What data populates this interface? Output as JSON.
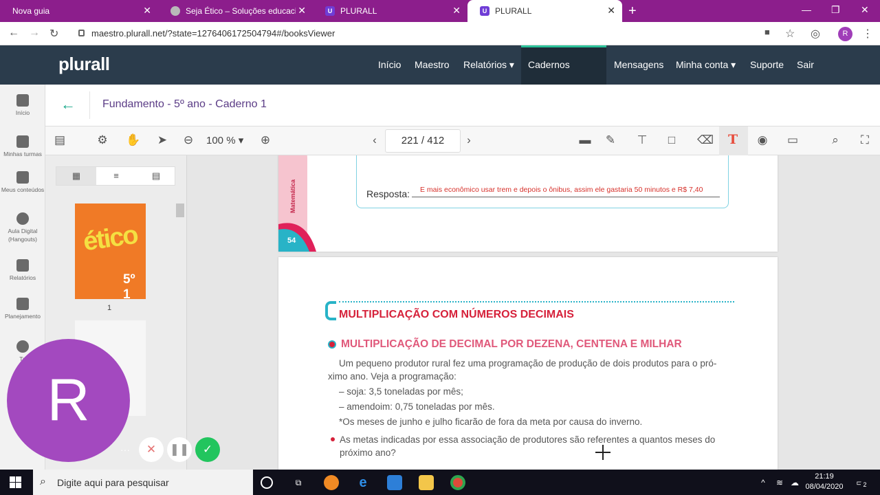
{
  "browser": {
    "tabs": [
      {
        "label": "Nova guia"
      },
      {
        "label": "Seja Ético – Soluções educacionais"
      },
      {
        "label": "PLURALL"
      },
      {
        "label": "PLURALL"
      }
    ],
    "url": "maestro.plurall.net/?state=1276406172504794#/booksViewer",
    "profile_initial": "R"
  },
  "site": {
    "logo": "plurall",
    "nav": [
      "Início",
      "Maestro",
      "Relatórios ▾",
      "Cadernos digitais",
      "Mensagens",
      "Minha conta ▾",
      "Suporte",
      "Sair"
    ]
  },
  "rail": {
    "items": [
      "Início",
      "Minhas turmas",
      "Meus conteúdos",
      "Aula Digital (Hangouts)",
      "Relatórios",
      "Planejamento",
      "Tu"
    ]
  },
  "viewer": {
    "book_title": "Fundamento - 5º ano - Caderno 1",
    "zoom": "100 %",
    "page_indicator": "221 / 412",
    "text_tool": "T"
  },
  "thumbs": {
    "cover_title": "ético",
    "cover_grade": "5º 1",
    "page_label": "1"
  },
  "page_top": {
    "subject": "Matemática",
    "page_number": "54",
    "answer_label": "Resposta:",
    "answer_text": "E mais econômico usar trem e depois o ônibus, assim ele gastaria 50 minutos  e R$ 7,40"
  },
  "page_bottom": {
    "heading": "MULTIPLICAÇÃO COM NÚMEROS DECIMAIS",
    "subheading": "MULTIPLICAÇÃO DE DECIMAL POR DEZENA, CENTENA E MILHAR",
    "intro_line1": "Um pequeno produtor rural fez uma programação de produção de dois produtos para o pró-",
    "intro_line2": "ximo ano. Veja a programação:",
    "item1": "– soja: 3,5 toneladas por mês;",
    "item2": "– amendoim: 0,75 toneladas por mês.",
    "note": "*Os meses de junho e julho ficarão de fora da meta por causa do inverno.",
    "question_line1": "As metas indicadas por essa associação de produtores são referentes a quantos meses do",
    "question_line2": "próximo ano?"
  },
  "overlay": {
    "avatar_letter": "R"
  },
  "taskbar": {
    "search_placeholder": "Digite aqui para pesquisar",
    "time": "21:19",
    "date": "08/04/2020",
    "notifications": "2"
  },
  "colors": {
    "tab_strip": "#8c1e8c",
    "site_header": "#2b3c4c",
    "accent_green": "#2bc39a",
    "heading_red": "#d6213a",
    "avatar_purple": "#a349bf"
  }
}
